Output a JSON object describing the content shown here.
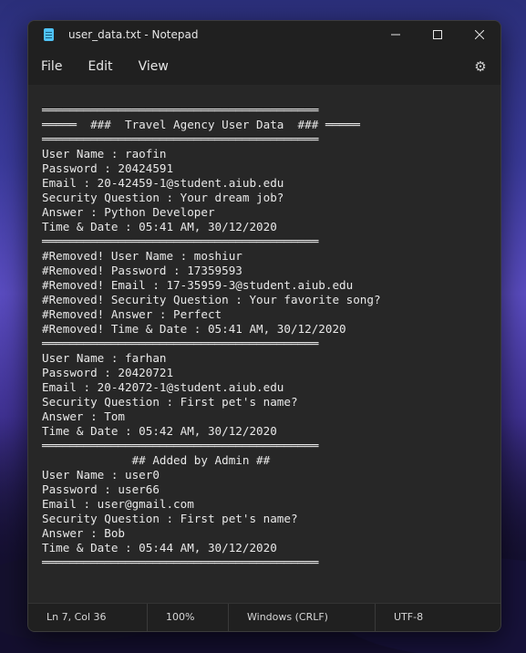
{
  "window": {
    "title": "user_data.txt - Notepad",
    "minimize_icon": "minimize-icon",
    "maximize_icon": "maximize-icon",
    "close_icon": "close-icon"
  },
  "menu": {
    "file": "File",
    "edit": "Edit",
    "view": "View",
    "settings_icon": "gear-icon"
  },
  "editor": {
    "lines": [
      "════════════════════════════════════════",
      "═════  ###  Travel Agency User Data  ### ═════",
      "════════════════════════════════════════",
      "User Name : raofin",
      "Password : 20424591",
      "Email : 20-42459-1@student.aiub.edu",
      "Security Question : Your dream job?",
      "Answer : Python Developer",
      "Time & Date : 05:41 AM, 30/12/2020",
      "════════════════════════════════════════",
      "#Removed! User Name : moshiur",
      "#Removed! Password : 17359593",
      "#Removed! Email : 17-35959-3@student.aiub.edu",
      "#Removed! Security Question : Your favorite song?",
      "#Removed! Answer : Perfect",
      "#Removed! Time & Date : 05:41 AM, 30/12/2020",
      "════════════════════════════════════════",
      "User Name : farhan",
      "Password : 20420721",
      "Email : 20-42072-1@student.aiub.edu",
      "Security Question : First pet's name?",
      "Answer : Tom",
      "Time & Date : 05:42 AM, 30/12/2020",
      "════════════════════════════════════════",
      "             ## Added by Admin ##",
      "User Name : user0",
      "Password : user66",
      "Email : user@gmail.com",
      "Security Question : First pet's name?",
      "Answer : Bob",
      "Time & Date : 05:44 AM, 30/12/2020",
      "════════════════════════════════════════"
    ]
  },
  "status": {
    "position": "Ln 7, Col 36",
    "zoom": "100%",
    "line_ending": "Windows (CRLF)",
    "encoding": "UTF-8"
  }
}
